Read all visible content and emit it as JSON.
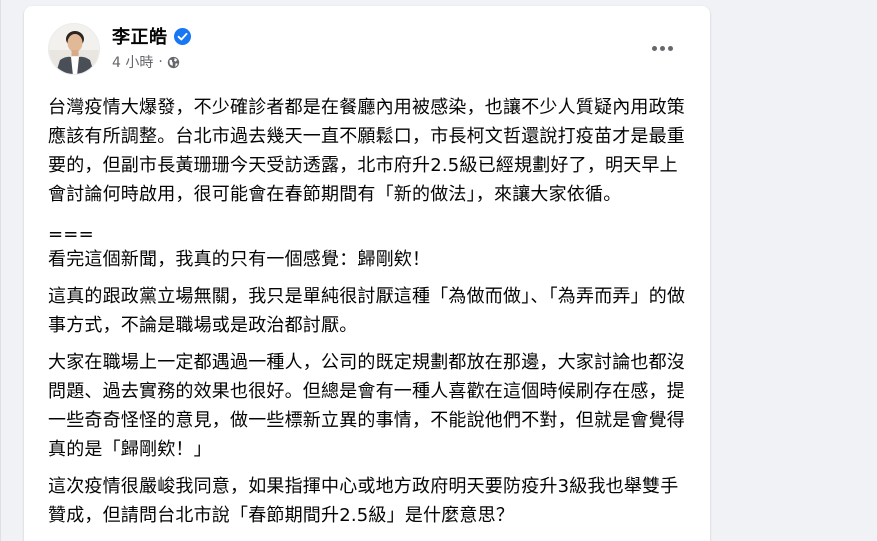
{
  "post": {
    "author": {
      "name": "李正皓",
      "verified_icon": "verified-badge-icon",
      "avatar_icon": "profile-photo"
    },
    "meta": {
      "time": "4 小時",
      "separator": "·",
      "privacy_icon": "globe-icon"
    },
    "more_menu_icon": "more-options-icon",
    "paragraphs": [
      "台灣疫情大爆發，不少確診者都是在餐廳內用被感染，也讓不少人質疑內用政策應該有所調整。台北市過去幾天一直不願鬆口，市長柯文哲還說打疫苗才是最重要的，但副市長黃珊珊今天受訪透露，北市府升2.5級已經規劃好了，明天早上會討論何時啟用，很可能會在春節期間有「新的做法」，來讓大家依循。",
      "===",
      "看完這個新聞，我真的只有一個感覺：歸剛欸！",
      "這真的跟政黨立場無關，我只是單純很討厭這種「為做而做」、「為弄而弄」的做事方式，不論是職場或是政治都討厭。",
      "大家在職場上一定都遇過一種人，公司的既定規劃都放在那邊，大家討論也都沒問題、過去實務的效果也很好。但總是會有一種人喜歡在這個時候刷存在感，提一些奇奇怪怪的意見，做一些標新立異的事情，不能說他們不對，但就是會覺得真的是「歸剛欸！」",
      "這次疫情很嚴峻我同意，如果指揮中心或地方政府明天要防疫升3級我也舉雙手贊成，但請問台北市說「春節期間升2.5級」是什麼意思？"
    ]
  },
  "colors": {
    "page_bg": "#f0f2f5",
    "card_bg": "#ffffff",
    "text_primary": "#050505",
    "text_secondary": "#65676b",
    "verified_blue": "#1877f2"
  }
}
